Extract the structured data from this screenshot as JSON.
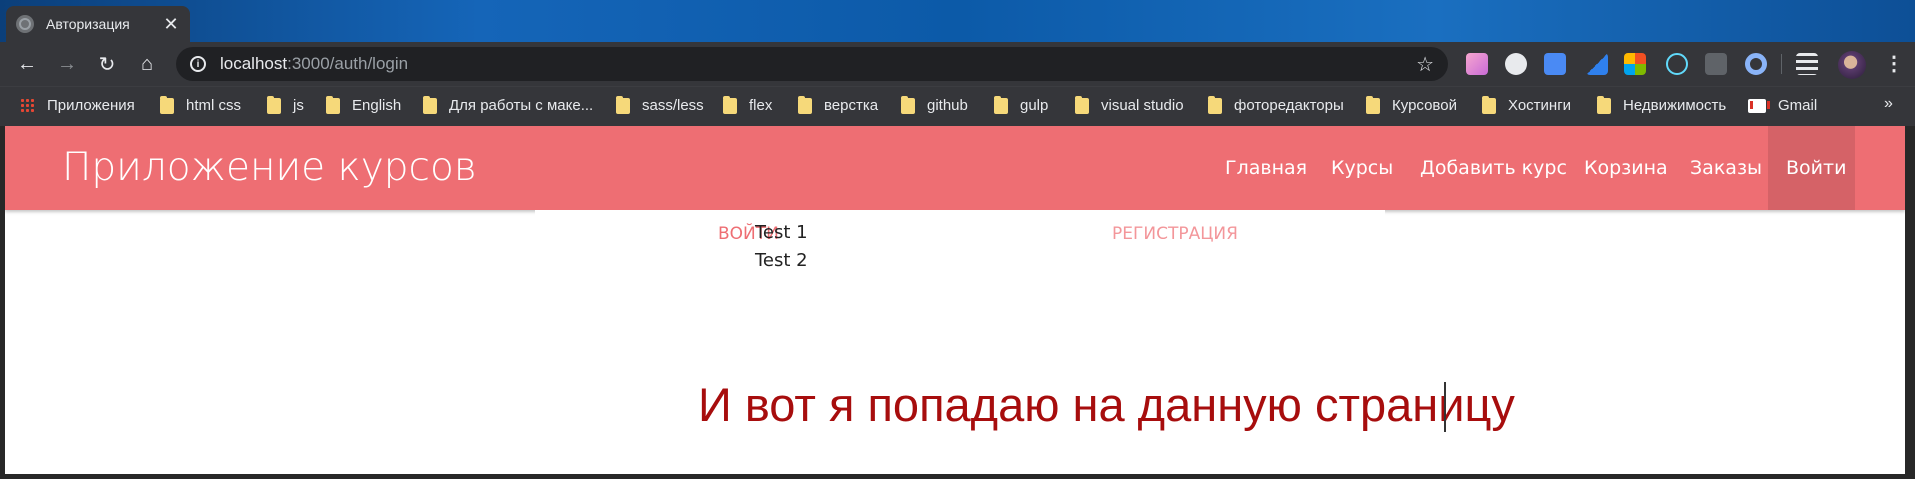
{
  "tab": {
    "title": "Авторизация",
    "close": "✕"
  },
  "toolbar": {
    "back": "←",
    "forward": "→",
    "reload": "↻",
    "home": "⌂",
    "url_host": "localhost",
    "url_path": ":3000/auth/login",
    "info": "i",
    "star": "☆",
    "menu": "⋮",
    "extensions": [
      {
        "name": "paint-extension-icon",
        "color": "#e86fb0"
      },
      {
        "name": "chat-extension-icon",
        "color": "#e8eaed"
      },
      {
        "name": "translate-extension-icon",
        "color": "#4a8af4"
      },
      {
        "name": "eyedropper-extension-icon",
        "color": "#2f80ed"
      },
      {
        "name": "windows-extension-icon",
        "color": "#f25022"
      },
      {
        "name": "react-extension-icon",
        "color": "#61dafb"
      },
      {
        "name": "layout-extension-icon",
        "color": "#5f6368"
      },
      {
        "name": "circle-extension-icon",
        "color": "#8ab4f8"
      },
      {
        "name": "playlist-extension-icon",
        "color": "#e8eaed"
      }
    ]
  },
  "bookmarks": {
    "items": [
      {
        "label": "Приложения",
        "icon": "apps-icon"
      },
      {
        "label": "html css",
        "icon": "folder-icon"
      },
      {
        "label": "js",
        "icon": "folder-icon"
      },
      {
        "label": "English",
        "icon": "folder-icon"
      },
      {
        "label": "Для работы с маке...",
        "icon": "folder-icon"
      },
      {
        "label": "sass/less",
        "icon": "folder-icon"
      },
      {
        "label": "flex",
        "icon": "folder-icon"
      },
      {
        "label": "верстка",
        "icon": "folder-icon"
      },
      {
        "label": "github",
        "icon": "folder-icon"
      },
      {
        "label": "gulp",
        "icon": "folder-icon"
      },
      {
        "label": "visual studio",
        "icon": "folder-icon"
      },
      {
        "label": "фоторедакторы",
        "icon": "folder-icon"
      },
      {
        "label": "Курсовой",
        "icon": "folder-icon"
      },
      {
        "label": "Хостинги",
        "icon": "folder-icon"
      },
      {
        "label": "Недвижимость",
        "icon": "folder-icon"
      },
      {
        "label": "Gmail",
        "icon": "gmail-icon"
      }
    ],
    "more": "»"
  },
  "page": {
    "brand": "Приложение курсов",
    "nav": [
      {
        "label": "Главная"
      },
      {
        "label": "Курсы"
      },
      {
        "label": "Добавить курс"
      },
      {
        "label": "Корзина"
      },
      {
        "label": "Заказы"
      },
      {
        "label": "Войти",
        "active": true
      }
    ],
    "tabs": [
      {
        "label": "Войти",
        "active": true
      },
      {
        "label": "Регистрация",
        "active": false
      }
    ],
    "items": [
      "Test 1",
      "Test 2"
    ],
    "caption": "И вот я попадаю на данную страницу"
  },
  "colors": {
    "navbar": "#ee6e73",
    "caption": "#a70d0d",
    "tab_strip": "#1565b8"
  }
}
